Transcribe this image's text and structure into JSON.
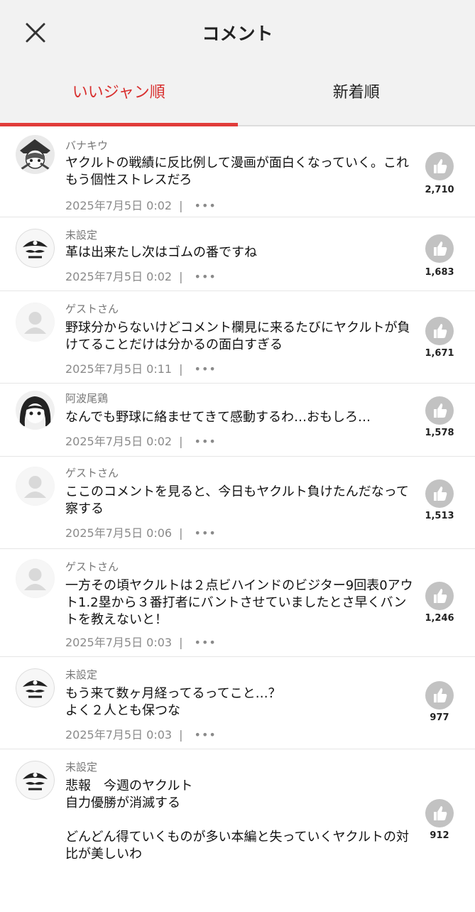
{
  "header": {
    "title": "コメント"
  },
  "tabs": [
    {
      "label": "いいジャン順",
      "active": true
    },
    {
      "label": "新着順",
      "active": false
    }
  ],
  "colors": {
    "accent": "#d8302f",
    "like_bg": "#c2c2c2"
  },
  "comments": [
    {
      "user": "バナキウ",
      "avatar": "manga-portrait-1",
      "text": "ヤクルトの戦績に反比例して漫画が面白くなっていく。これもう個性ストレスだろ",
      "date": "2025年7月5日 0:02",
      "sep": "|",
      "more": "•••",
      "likes": "2,710"
    },
    {
      "user": "未設定",
      "avatar": "pirate-skull-icon",
      "text": "革は出来たし次はゴムの番ですね",
      "date": "2025年7月5日 0:02",
      "sep": "|",
      "more": "•••",
      "likes": "1,683"
    },
    {
      "user": "ゲストさん",
      "avatar": "guest-person-icon",
      "text": "野球分からないけどコメント欄見に来るたびにヤクルトが負けてることだけは分かるの面白すぎる",
      "date": "2025年7月5日 0:11",
      "sep": "|",
      "more": "•••",
      "likes": "1,671"
    },
    {
      "user": "阿波尾鶏",
      "avatar": "manga-portrait-2",
      "text": "なんでも野球に絡ませてきて感動するわ…おもしろ…",
      "date": "2025年7月5日 0:02",
      "sep": "|",
      "more": "•••",
      "likes": "1,578"
    },
    {
      "user": "ゲストさん",
      "avatar": "guest-person-icon",
      "text": "ここのコメントを見ると、今日もヤクルト負けたんだなって察する",
      "date": "2025年7月5日 0:06",
      "sep": "|",
      "more": "•••",
      "likes": "1,513"
    },
    {
      "user": "ゲストさん",
      "avatar": "guest-person-icon",
      "text": "一方その頃ヤクルトは２点ビハインドのビジター9回表0アウト1.2塁から３番打者にバントさせていましたとさ早くバントを教えないと！",
      "date": "2025年7月5日 0:03",
      "sep": "|",
      "more": "•••",
      "likes": "1,246"
    },
    {
      "user": "未設定",
      "avatar": "pirate-skull-icon",
      "text": "もう来て数ヶ月経ってるってこと…？\nよく２人とも保つな",
      "date": "2025年7月5日 0:03",
      "sep": "|",
      "more": "•••",
      "likes": "977"
    },
    {
      "user": "未設定",
      "avatar": "pirate-skull-icon",
      "text": "悲報　今週のヤクルト\n自力優勝が消滅する\n\nどんどん得ていくものが多い本編と失っていくヤクルトの対比が美しいわ",
      "date": "",
      "sep": "",
      "more": "",
      "likes": "912"
    }
  ]
}
